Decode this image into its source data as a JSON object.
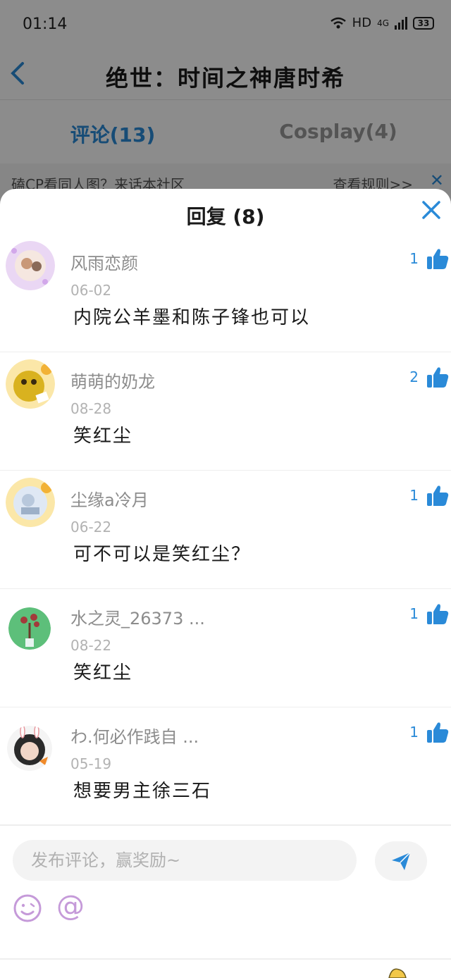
{
  "status_bar": {
    "time": "01:14",
    "network": "HD",
    "signal": "4G",
    "battery": "33"
  },
  "nav": {
    "title": "绝世：时间之神唐时希"
  },
  "tabs": [
    {
      "label": "评论(13)",
      "active": true
    },
    {
      "label": "Cosplay(4)",
      "active": false
    }
  ],
  "banner": {
    "text": "磕CP看同人图？来话本社区",
    "link": "查看规则>>"
  },
  "reply_sheet": {
    "title": "回复 (8)"
  },
  "comments": [
    {
      "username": "风雨恋颜",
      "date": "06-02",
      "text": "内院公羊墨和陈子锋也可以",
      "likes": "1"
    },
    {
      "username": "萌萌的奶龙",
      "date": "08-28",
      "text": "笑红尘",
      "likes": "2"
    },
    {
      "username": "尘缘a冷月",
      "date": "06-22",
      "text": "可不可以是笑红尘？",
      "likes": "1"
    },
    {
      "username": "水之灵_26373 ...",
      "date": "08-22",
      "text": "笑红尘",
      "likes": "1"
    },
    {
      "username": "わ.何必作践自 ...",
      "date": "05-19",
      "text": "想要男主徐三石",
      "likes": "1"
    }
  ],
  "composer": {
    "placeholder": "发布评论，赢奖励~",
    "at_symbol": "@"
  },
  "colors": {
    "accent": "#2a8ad8",
    "icon_purple": "#c59ad9"
  },
  "icons": [
    "back-arrow-icon",
    "close-icon",
    "like-thumb-icon",
    "send-icon",
    "emoji-icon",
    "at-icon"
  ]
}
